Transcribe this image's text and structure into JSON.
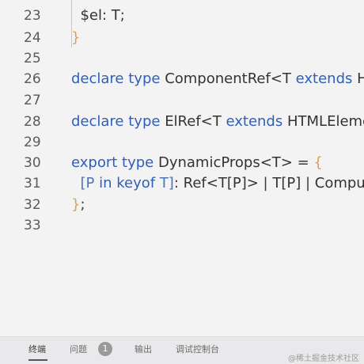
{
  "editor": {
    "lines": [
      {
        "n": "23",
        "text": "  $el: T;"
      },
      {
        "n": "24",
        "text": "}"
      },
      {
        "n": "25",
        "text": ""
      },
      {
        "n": "26",
        "text": "declare type ComponentRef<T extends H"
      },
      {
        "n": "27",
        "text": ""
      },
      {
        "n": "28",
        "text": "declare type ElRef<T extends HTMLEleme"
      },
      {
        "n": "29",
        "text": ""
      },
      {
        "n": "30",
        "text": "export type DynamicProps<T> = {"
      },
      {
        "n": "31",
        "text": "  [P in keyof T]: Ref<T[P]> | T[P] | Comput"
      },
      {
        "n": "32",
        "text": "};"
      },
      {
        "n": "33",
        "text": ""
      }
    ]
  },
  "panel": {
    "tabs": [
      "终端",
      "问题",
      "输出",
      "调试控制台"
    ],
    "problems_count": "1"
  },
  "watermark": "@稀土掘金技术社区",
  "colors": {
    "keyword": "#2f5fb8",
    "bracket": "#d9a15a",
    "text": "#3a3a3a"
  }
}
